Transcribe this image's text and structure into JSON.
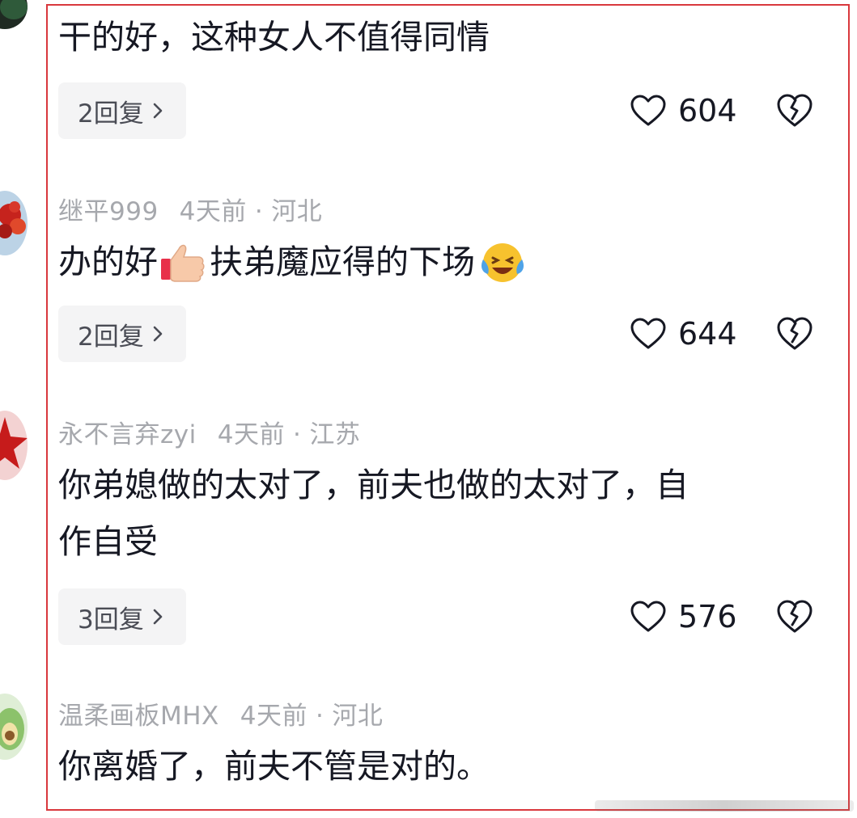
{
  "comments": [
    {
      "text": "干的好，这种女人不值得同情",
      "reply_label": "2回复",
      "like_count": "604"
    },
    {
      "username": "继平999",
      "time": "4天前",
      "dot": "·",
      "location": "河北",
      "text_part1": "办的好",
      "text_part2": "扶弟魔应得的下场",
      "reply_label": "2回复",
      "like_count": "644"
    },
    {
      "username": "永不言弃zyi",
      "time": "4天前",
      "dot": "·",
      "location": "江苏",
      "text_line1": "你弟媳做的太对了，前夫也做的太对了，自",
      "text_line2": "作自受",
      "reply_label": "3回复",
      "like_count": "576"
    },
    {
      "username": "温柔画板MHX",
      "time": "4天前",
      "dot": "·",
      "location": "河北",
      "text": "你离婚了，前夫不管是对的。"
    }
  ],
  "icons": {
    "like": "heart-icon",
    "dislike": "broken-heart-icon",
    "reply_arrow": "chevron-right-icon"
  },
  "colors": {
    "highlight_border": "#d9383d",
    "meta_text": "#a6a8ad",
    "reply_bg": "#f4f4f5"
  }
}
